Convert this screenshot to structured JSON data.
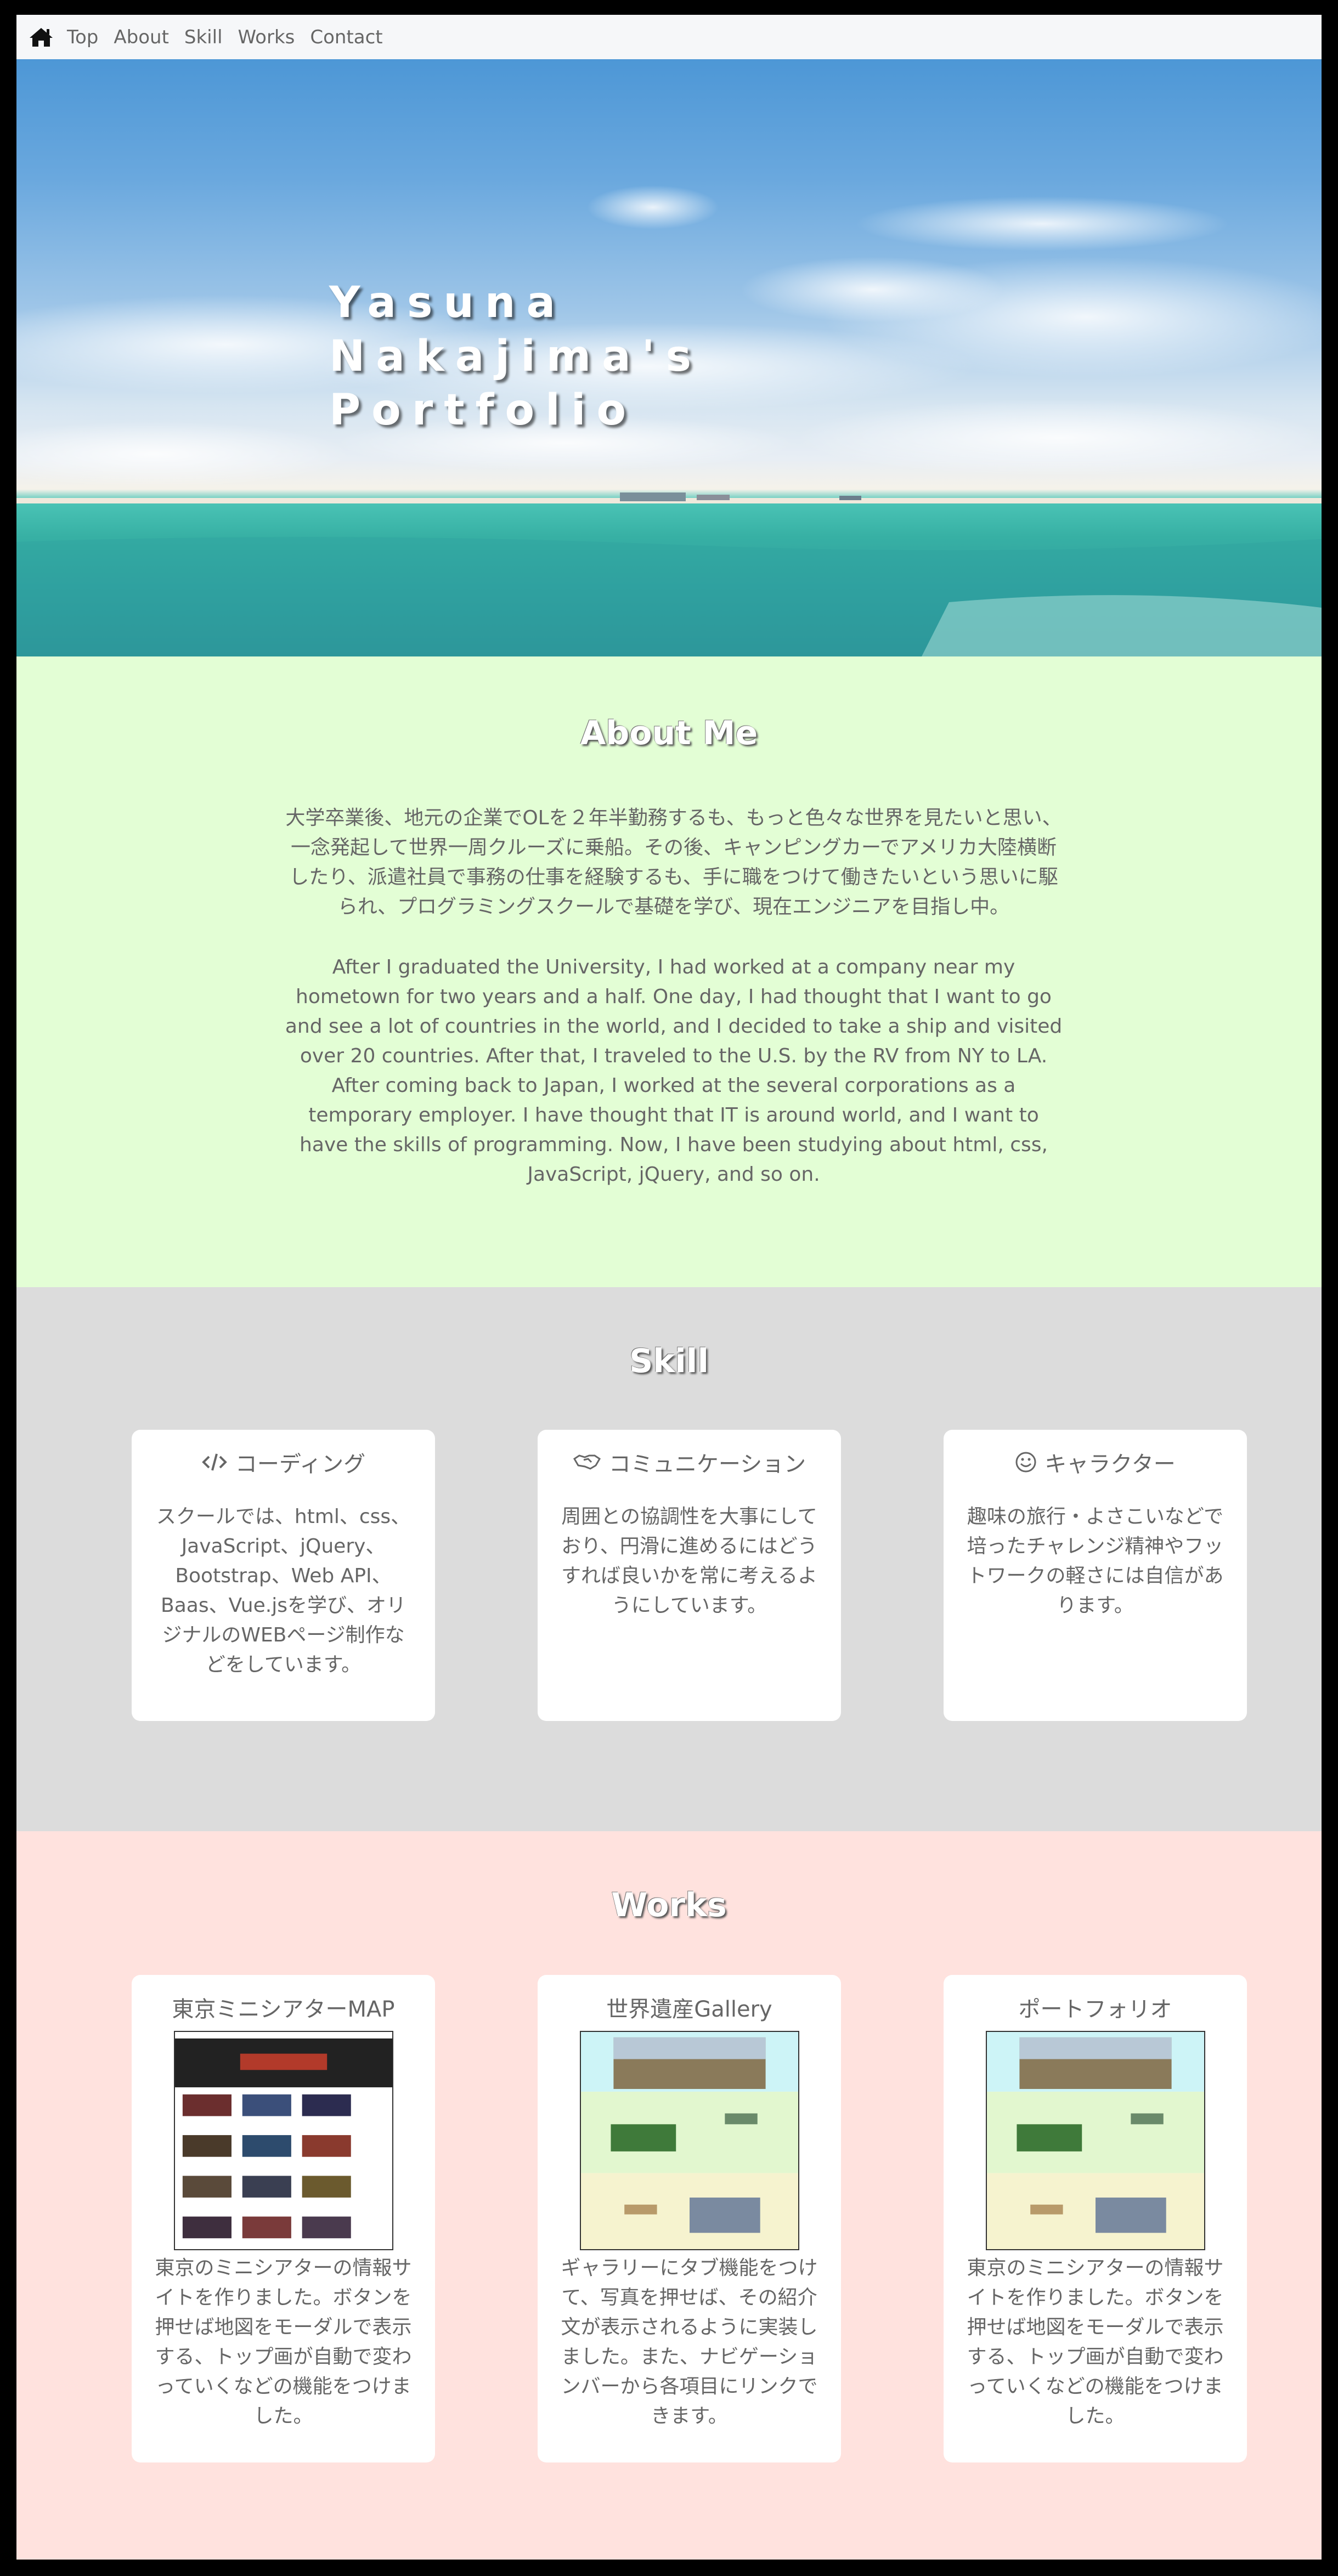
{
  "nav": {
    "home_icon": "home-icon",
    "items": [
      {
        "label": "Top"
      },
      {
        "label": "About"
      },
      {
        "label": "Skill"
      },
      {
        "label": "Works"
      },
      {
        "label": "Contact"
      }
    ]
  },
  "hero": {
    "title_line1": "Yasuna Nakajima's",
    "title_line2": "Portfolio"
  },
  "about": {
    "title": "About Me",
    "text_ja": "大学卒業後、地元の企業でOLを２年半勤務するも、もっと色々な世界を見たいと思い、一念発起して世界一周クルーズに乗船。その後、キャンピングカーでアメリカ大陸横断したり、派遣社員で事務の仕事を経験するも、手に職をつけて働きたいという思いに駆られ、プログラミングスクールで基礎を学び、現在エンジニアを目指し中。",
    "text_en": "After I graduated the University, I had worked at a company near my hometown for two years and a half. One day, I had thought that I want to go and see a lot of countries in the world, and I decided to take a ship and visited over 20 countries. After that, I traveled to the U.S. by the RV from NY to LA. After coming back to Japan, I worked at the several corporations as a temporary employer. I have thought that IT is around world, and I want to have the skills of programming. Now, I have been studying about html, css, JavaScript, jQuery, and so on."
  },
  "skill": {
    "title": "Skill",
    "cards": [
      {
        "icon": "code-icon",
        "title": "コーディング",
        "text": "スクールでは、html、css、JavaScript、jQuery、Bootstrap、Web API、Baas、Vue.jsを学び、オリジナルのWEBページ制作などをしています。"
      },
      {
        "icon": "handshake-icon",
        "title": "コミュニケーション",
        "text": "周囲との協調性を大事にしており、円滑に進めるにはどうすれば良いかを常に考えるようにしています。"
      },
      {
        "icon": "smile-icon",
        "title": "キャラクター",
        "text": "趣味の旅行・よさこいなどで培ったチャレンジ精神やフットワークの軽さには自信があります。"
      }
    ]
  },
  "works": {
    "title": "Works",
    "cards": [
      {
        "title": "東京ミニシアターMAP",
        "text": "東京のミニシアターの情報サイトを作りました。ボタンを押せば地図をモーダルで表示する、トップ画が自動で変わっていくなどの機能をつけました。"
      },
      {
        "title": "世界遺産Gallery",
        "text": "ギャラリーにタブ機能をつけて、写真を押せば、その紹介文が表示されるように実装しました。また、ナビゲーションバーから各項目にリンクできます。"
      },
      {
        "title": "ポートフォリオ",
        "text": "東京のミニシアターの情報サイトを作りました。ボタンを押せば地図をモーダルで表示する、トップ画が自動で変わっていくなどの機能をつけました。"
      }
    ]
  }
}
